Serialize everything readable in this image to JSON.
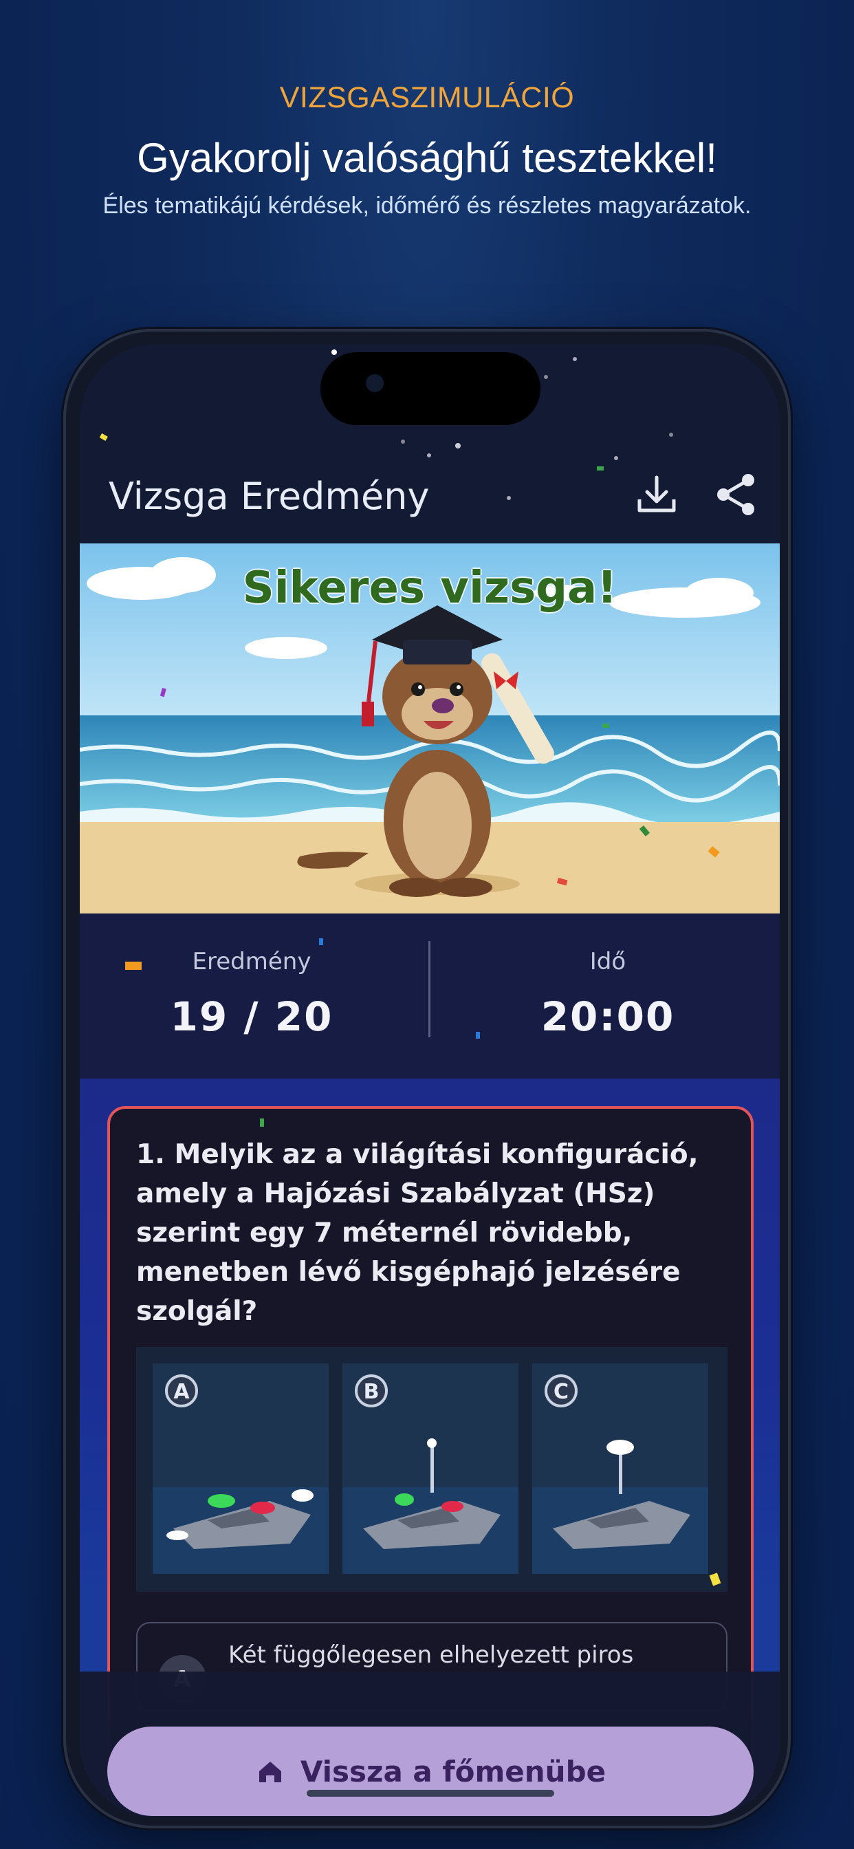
{
  "header": {
    "eyebrow": "VIZSGASZIMULÁCIÓ",
    "headline": "Gyakorolj valósághű tesztekkel!",
    "subline": "Éles tematikájú kérdések, időmérő és részletes magyarázatok."
  },
  "app": {
    "title": "Vizsga Eredmény",
    "download_icon": "download-icon",
    "share_icon": "share-icon"
  },
  "hero": {
    "title": "Sikeres vizsga!"
  },
  "stats": {
    "score_label": "Eredmény",
    "score_value": "19 / 20",
    "time_label": "Idő",
    "time_value": "20:00"
  },
  "question": {
    "text": "1. Melyik az a világítási konfiguráció, amely a Hajózási Szabályzat (HSz) szerint egy 7 méternél rövidebb, menetben lévő kisgéphajó jelzésére szolgál?",
    "image_labels": [
      "A",
      "B",
      "C"
    ],
    "options": [
      {
        "letter": "A",
        "text": "Két függőlegesen elhelyezett piros"
      }
    ]
  },
  "footer": {
    "back_label": "Vissza a főmenübe",
    "back_icon": "home-icon"
  },
  "colors": {
    "eyebrow": "#f0a53a",
    "card_border": "#e0545a",
    "button_bg": "#b6a0d8",
    "button_text": "#3a2160"
  }
}
